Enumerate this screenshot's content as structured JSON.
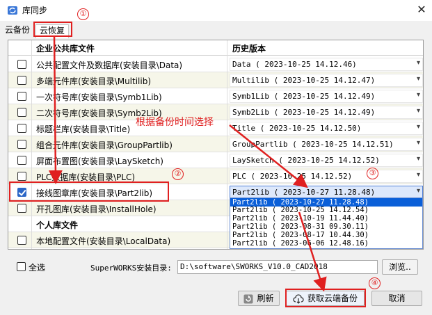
{
  "window": {
    "title": "库同步",
    "close": "✕"
  },
  "tabs": [
    {
      "label": "云备份"
    },
    {
      "label": "云恢复"
    }
  ],
  "grid": {
    "headers": {
      "library": "企业公共库文件",
      "history": "历史版本"
    },
    "rows": [
      {
        "name": "公共配置文件及数据库(安装目录\\Data)",
        "history": "Data (    2023-10-25 14.12.46)",
        "checked": false
      },
      {
        "name": "多端元件库(安装目录\\Multilib)",
        "history": "Multilib (    2023-10-25 14.12.47)",
        "checked": false
      },
      {
        "name": "一次符号库(安装目录\\Symb1Lib)",
        "history": "Symb1Lib (    2023-10-25 14.12.49)",
        "checked": false
      },
      {
        "name": "二次符号库(安装目录\\Symb2Lib)",
        "history": "Symb2Lib (    2023-10-25 14.12.49)",
        "checked": false
      },
      {
        "name": "标题栏库(安装目录\\Title)",
        "history": "Title (    2023-10-25 14.12.50)",
        "checked": false
      },
      {
        "name": "组合元件库(安装目录\\GroupPartlib)",
        "history": "GroupPartlib (    2023-10-25 14.12.51)",
        "checked": false
      },
      {
        "name": "屏面布置图(安装目录\\LaySketch)",
        "history": "LaySketch (    2023-10-25 14.12.52)",
        "checked": false
      },
      {
        "name": "PLC数据库(安装目录\\PLC)",
        "history": "PLC (    2023-10-25 14.12.52)",
        "checked": false
      },
      {
        "name": "接线图章库(安装目录\\Part2lib)",
        "history": "Part2lib (    2023-10-27 11.28.48)",
        "checked": true
      },
      {
        "name": "开孔图库(安装目录\\InstallHole)",
        "history": "",
        "checked": false
      }
    ],
    "section_label": "个人库文件",
    "personal_rows": [
      {
        "name": "本地配置文件(安装目录\\LocalData)",
        "history": "",
        "checked": false
      }
    ]
  },
  "dropdown": {
    "items": [
      "Part2lib (    2023-10-27 11.28.48)",
      "Part2lib (    2023-10-25 14.12.54)",
      "Part2lib (    2023-10-19 11.44.40)",
      "Part2lib (    2023-08-31 09.30.11)",
      "Part2lib (    2023-08-17 10.44.30)",
      "Part2lib (    2023-06-06 12.48.16)"
    ],
    "selected_index": 0
  },
  "bottom": {
    "select_all": "全选",
    "install_label": "SuperWORKS安装目录:",
    "install_path": "D:\\software\\SWORKS_V10.0_CAD2018",
    "browse": "浏览..",
    "refresh": "刷新",
    "fetch": "获取云端备份",
    "cancel": "取消"
  },
  "annotations": {
    "step1": "①",
    "step2": "②",
    "step3": "③",
    "step4": "④",
    "hint": "根据备份时间选择"
  },
  "colors": {
    "accent": "#2c67c7",
    "annotation": "#e02020",
    "highlight": "#0a5fd8"
  }
}
